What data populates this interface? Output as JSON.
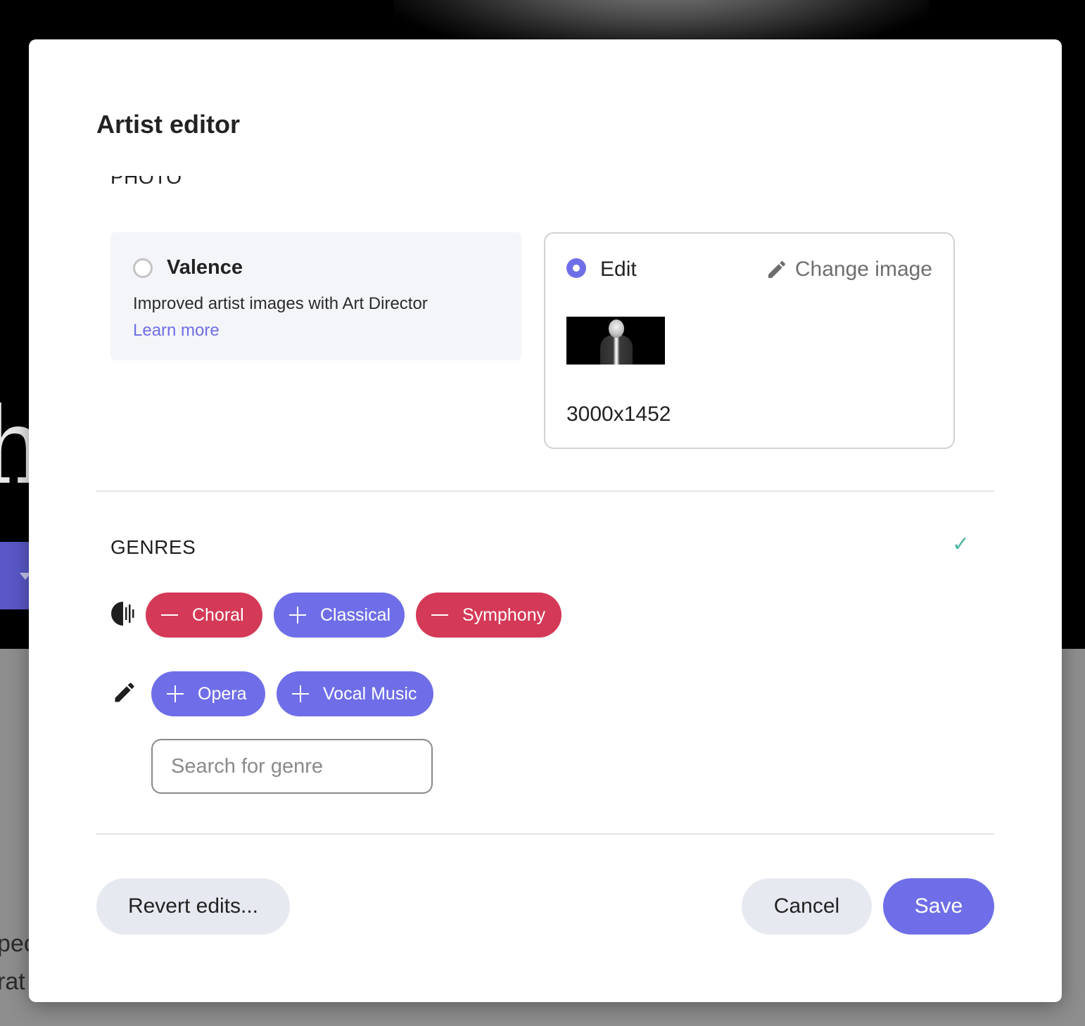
{
  "modal": {
    "title": "Artist editor"
  },
  "photo": {
    "section_label": "PHOTO",
    "valence": {
      "title": "Valence",
      "description": "Improved artist images with Art Director",
      "link": "Learn more",
      "selected": false
    },
    "edit": {
      "title": "Edit",
      "change_image": "Change image",
      "dimensions": "3000x1452",
      "selected": true
    }
  },
  "genres": {
    "section_label": "GENRES",
    "status_icon": "check-icon",
    "row1_icon": "audio-waveform-icon",
    "row1": [
      {
        "label": "Choral",
        "action": "remove",
        "color": "#d43a57"
      },
      {
        "label": "Classical",
        "action": "add",
        "color": "#6f6ee8"
      },
      {
        "label": "Symphony",
        "action": "remove",
        "color": "#d43a57"
      }
    ],
    "row2_icon": "pencil-icon",
    "row2": [
      {
        "label": "Opera",
        "action": "add",
        "color": "#6f6ee8"
      },
      {
        "label": "Vocal Music",
        "action": "add",
        "color": "#6f6ee8"
      }
    ],
    "search": {
      "placeholder": "Search for genre",
      "value": ""
    }
  },
  "footer": {
    "revert": "Revert edits...",
    "cancel": "Cancel",
    "save": "Save"
  },
  "background": {
    "letter": "h",
    "text_line1": "pec",
    "text_line2": "rat"
  },
  "colors": {
    "accent": "#6f6ee8",
    "remove": "#d43a57",
    "check": "#4fb8a5"
  }
}
